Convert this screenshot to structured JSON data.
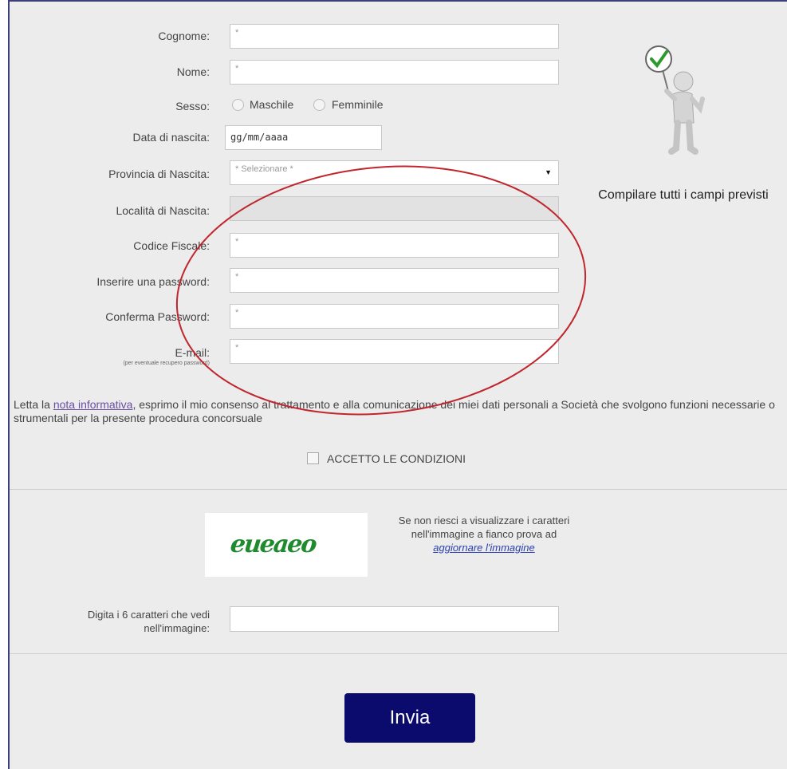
{
  "form": {
    "fields": [
      {
        "label": "Cognome:",
        "value": "*"
      },
      {
        "label": "Nome:",
        "value": "*"
      },
      {
        "label": "Sesso:"
      },
      {
        "label": "Data di nascita:",
        "value": "gg/mm/aaaa"
      },
      {
        "label": "Provincia di Nascita:",
        "value": "* Selezionare *"
      },
      {
        "label": "Località di Nascita:",
        "value": ""
      },
      {
        "label": "Codice Fiscale:",
        "value": "*"
      },
      {
        "label": "Inserire una password:",
        "value": "*"
      },
      {
        "label": "Conferma Password:",
        "value": "*"
      },
      {
        "label": "E-mail:",
        "value": "*",
        "note": "(per eventuale recupero password)"
      }
    ],
    "gender_options": [
      "Maschile",
      "Femminile"
    ]
  },
  "side_note": "Compilare tutti i campi previsti",
  "consent": {
    "prefix": "Letta la ",
    "link": "nota informativa",
    "suffix": ", esprimo il mio consenso al trattamento e alla comunicazione dei miei dati personali a Società che svolgono funzioni necessarie o strumentali per la presente procedura concorsuale",
    "accept_label": "ACCETTO LE CONDIZIONI"
  },
  "captcha": {
    "image_text": "eueaeo",
    "help_text": "Se non riesci a visualizzare i caratteri nell'immagine a fianco prova ad",
    "refresh_link": "aggiornare l'immagine",
    "input_label": "Digita i 6 caratteri che vedi nell'immagine:"
  },
  "submit_label": "Invia",
  "colors": {
    "annotation": "#c0262e",
    "submit_bg": "#0b0b6e",
    "panel_bg": "#ececec",
    "check": "#2e9a2e"
  }
}
